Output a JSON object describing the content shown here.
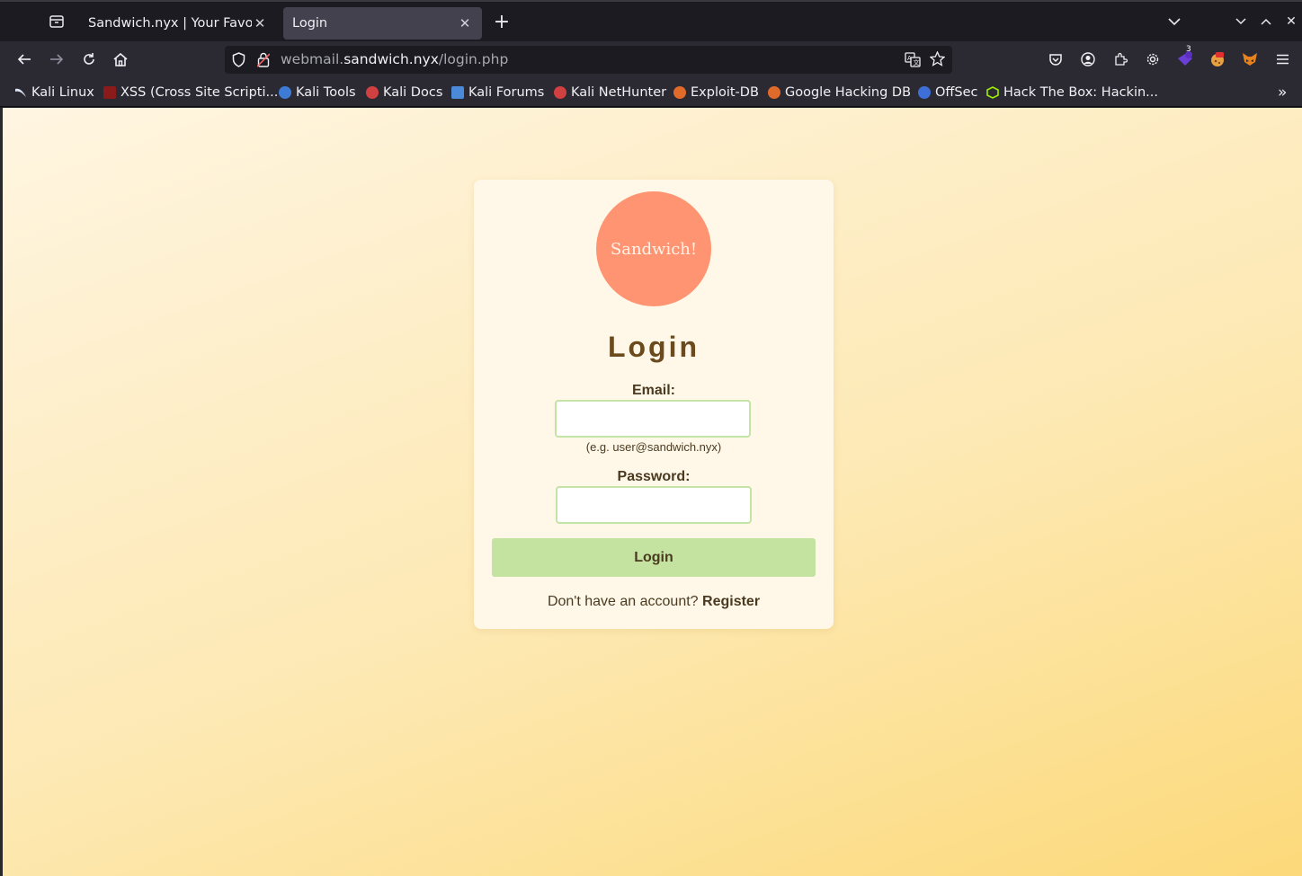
{
  "browser": {
    "tabs": [
      {
        "title": "Sandwich.nyx | Your Favori",
        "active": false
      },
      {
        "title": "Login",
        "active": true
      }
    ],
    "new_tab": "+",
    "url": {
      "prefix": "webmail.",
      "domain": "sandwich.nyx",
      "path": "/login.php"
    },
    "extension_badge": "3",
    "bookmarks": [
      {
        "label": "Kali Linux",
        "icon_color": "#3b6fd0"
      },
      {
        "label": "XSS (Cross Site Scripti...",
        "icon_color": "#8b1a1a"
      },
      {
        "label": "Kali Tools",
        "icon_color": "#3d7bd6"
      },
      {
        "label": "Kali Docs",
        "icon_color": "#d04040"
      },
      {
        "label": "Kali Forums",
        "icon_color": "#4a8ad8"
      },
      {
        "label": "Kali NetHunter",
        "icon_color": "#d04040"
      },
      {
        "label": "Exploit-DB",
        "icon_color": "#e06a2a"
      },
      {
        "label": "Google Hacking DB",
        "icon_color": "#e06a2a"
      },
      {
        "label": "OffSec",
        "icon_color": "#3d6fd6"
      },
      {
        "label": "Hack The Box: Hackin...",
        "icon_color": "#9fef00"
      }
    ]
  },
  "page": {
    "logo_text": "Sandwich!",
    "title": "Login",
    "email_label": "Email:",
    "email_value": "",
    "email_hint": "(e.g. user@sandwich.nyx)",
    "password_label": "Password:",
    "password_value": "",
    "login_button": "Login",
    "register_prompt": "Don't have an account?",
    "register_link": "Register"
  },
  "colors": {
    "logo": "#ff9472",
    "button": "#c5e3a0",
    "title_text": "#6b4a1e"
  }
}
